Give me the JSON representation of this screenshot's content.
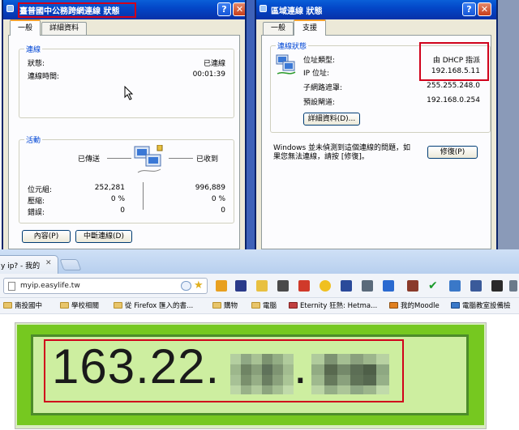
{
  "left_dialog": {
    "title": "臺普國中公務跨網連線 狀態",
    "help_label": "?",
    "close_label": "✕",
    "tabs": [
      {
        "label": "一般"
      },
      {
        "label": "詳細資料"
      }
    ],
    "connection": {
      "title": "連線",
      "status_label": "狀態:",
      "status_value": "已連線",
      "duration_label": "連線時間:",
      "duration_value": "00:01:39"
    },
    "activity": {
      "title": "活動",
      "sent_label": "已傳送",
      "received_label": "已收到",
      "bytes_label": "位元組:",
      "bytes_sent": "252,281",
      "bytes_received": "996,889",
      "compression_label": "壓縮:",
      "compression_sent": "0 %",
      "compression_received": "0 %",
      "errors_label": "錯誤:",
      "errors_sent": "0",
      "errors_received": "0"
    },
    "buttons": {
      "properties": "內容(P)",
      "disconnect": "中斷連線(D)"
    }
  },
  "right_dialog": {
    "title": "區域連線 狀態",
    "help_label": "?",
    "close_label": "✕",
    "tabs": [
      {
        "label": "一般"
      },
      {
        "label": "支援"
      }
    ],
    "status": {
      "title": "連線狀態",
      "addr_type_label": "位址類型:",
      "addr_type_value": "由 DHCP 指派",
      "ip_label": "IP 位址:",
      "ip_value": "192.168.5.11",
      "subnet_label": "子網路遮罩:",
      "subnet_value": "255.255.248.0",
      "gateway_label": "預設閘道:",
      "gateway_value": "192.168.0.254",
      "details_button": "詳細資料(D)..."
    },
    "repair_text": "Windows 並未偵測到這個連線的問題，如果您無法連線，請按 [修復]。",
    "repair_button": "修復(P)"
  },
  "browser": {
    "tab_title": "y ip? - 我的",
    "tab_close": "✕",
    "url": "myip.easylife.tw",
    "bookmarks": [
      {
        "label": "南投國中",
        "icon": "folder-icon"
      },
      {
        "label": "學校相關",
        "icon": "folder-icon"
      },
      {
        "label": "從 Firefox 匯入的書...",
        "icon": "folder-icon"
      },
      {
        "label": "購物",
        "icon": "folder-icon"
      },
      {
        "label": "電腦",
        "icon": "folder-icon"
      },
      {
        "label": "Eternity 狂熱: Hetma...",
        "icon": "page-icon"
      },
      {
        "label": "我的Moodle",
        "icon": "moodle-icon"
      },
      {
        "label": "電腦教室設備檢",
        "icon": "page-icon"
      }
    ],
    "ip_display": {
      "visible_text": "163.22.",
      "dot": "."
    }
  },
  "colors": {
    "xp_title_blue": "#0347c8",
    "dialog_bg": "#ece9d8",
    "group_title_blue": "#0046d5",
    "highlight_red": "#d0021b",
    "ip_green": "#76c820",
    "ip_panel": "#cdeea0"
  }
}
